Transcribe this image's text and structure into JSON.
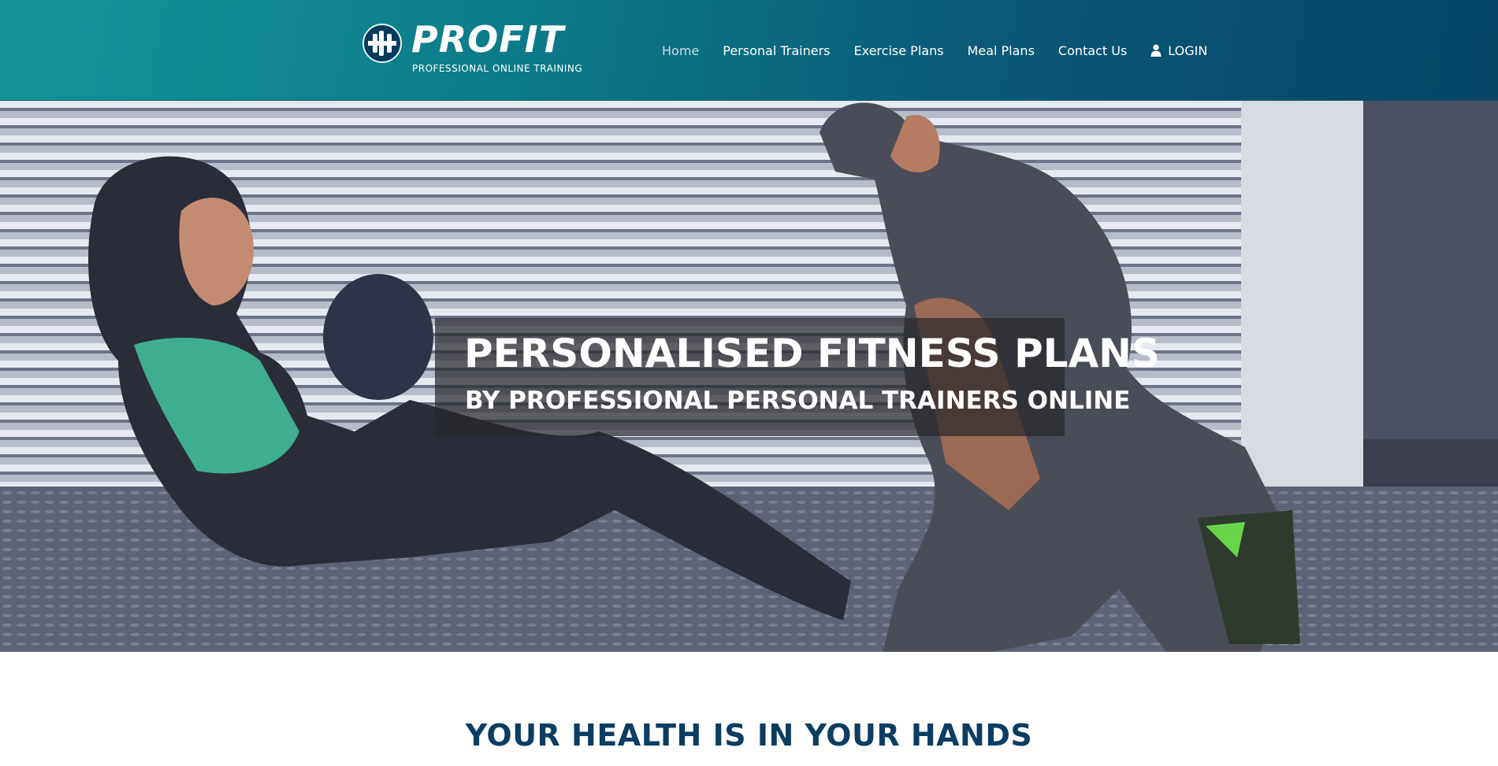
{
  "header": {
    "logo": {
      "wordmark": "PROFIT",
      "tagline": "PROFESSIONAL ONLINE TRAINING",
      "icon": "dumbbell-icon"
    },
    "nav": [
      {
        "label": "Home",
        "active": true
      },
      {
        "label": "Personal Trainers",
        "active": false
      },
      {
        "label": "Exercise Plans",
        "active": false
      },
      {
        "label": "Meal Plans",
        "active": false
      },
      {
        "label": "Contact Us",
        "active": false
      }
    ],
    "login": {
      "label": "LOGIN",
      "icon": "user-icon"
    }
  },
  "hero": {
    "title": "PERSONALISED FITNESS PLANS",
    "subtitle": "BY PROFESSIONAL PERSONAL TRAINERS ONLINE",
    "image": "woman-with-medicine-ball-and-personal-trainer-photo"
  },
  "section": {
    "title": "YOUR HEALTH IS IN YOUR HANDS"
  },
  "colors": {
    "header_gradient_start": "#14959a",
    "header_gradient_end": "#064466",
    "heading_color": "#0b3d62",
    "hero_overlay": "#28282c"
  }
}
